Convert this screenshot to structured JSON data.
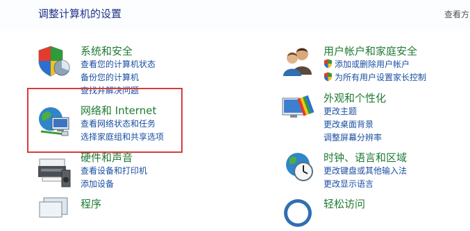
{
  "header": {
    "title": "调整计算机的设置",
    "view_by": "查看方"
  },
  "left": [
    {
      "title": "系统和安全",
      "links": [
        "查看您的计算机状态",
        "备份您的计算机",
        "查找并解决问题"
      ]
    },
    {
      "title": "网络和 Internet",
      "links": [
        "查看网络状态和任务",
        "选择家庭组和共享选项"
      ]
    },
    {
      "title": "硬件和声音",
      "links": [
        "查看设备和打印机",
        "添加设备"
      ]
    },
    {
      "title": "程序",
      "links": []
    }
  ],
  "right": [
    {
      "title": "用户帐户和家庭安全",
      "links": [
        "添加或删除用户帐户",
        "为所有用户设置家长控制"
      ]
    },
    {
      "title": "外观和个性化",
      "links": [
        "更改主题",
        "更改桌面背景",
        "调整屏幕分辨率"
      ]
    },
    {
      "title": "时钟、语言和区域",
      "links": [
        "更改键盘或其他输入法",
        "更改显示语言"
      ]
    },
    {
      "title": "轻松访问",
      "links": []
    }
  ],
  "highlight_color": "#d63a3a",
  "colors": {
    "title": "#1e3287",
    "category": "#1f7a34",
    "link": "#1a4ea2"
  }
}
